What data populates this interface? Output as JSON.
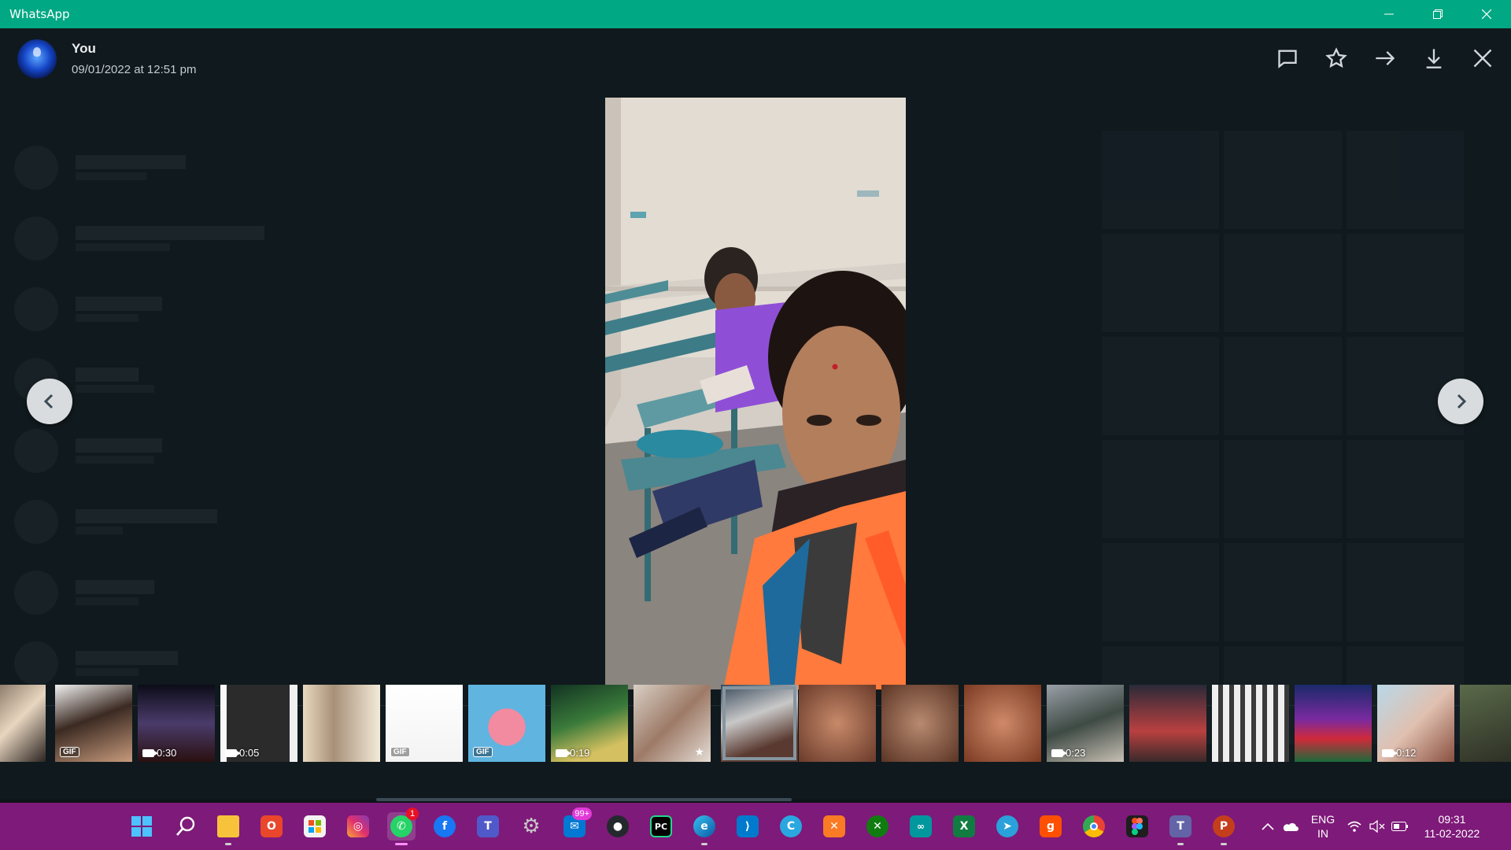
{
  "window": {
    "title": "WhatsApp"
  },
  "header": {
    "sender": "You",
    "timestamp": "09/01/2022 at 12:51 pm",
    "actions": [
      "reply-icon",
      "star-icon",
      "forward-icon",
      "download-icon",
      "close-icon"
    ]
  },
  "thumbnails": [
    {
      "type": "image"
    },
    {
      "type": "gif",
      "label": "GIF"
    },
    {
      "type": "video",
      "duration": "0:30"
    },
    {
      "type": "video",
      "duration": "0:05"
    },
    {
      "type": "image"
    },
    {
      "type": "gif",
      "label": "GIF"
    },
    {
      "type": "gif",
      "label": "GIF"
    },
    {
      "type": "video",
      "duration": "0:19"
    },
    {
      "type": "image",
      "starred": true
    },
    {
      "type": "image",
      "selected": true
    },
    {
      "type": "image"
    },
    {
      "type": "image"
    },
    {
      "type": "image"
    },
    {
      "type": "video",
      "duration": "0:23"
    },
    {
      "type": "image"
    },
    {
      "type": "image"
    },
    {
      "type": "image"
    },
    {
      "type": "video",
      "duration": "0:12"
    },
    {
      "type": "image"
    }
  ],
  "taskbar": {
    "whatsapp_badge": "1",
    "mail_badge": "99+",
    "language_line1": "ENG",
    "language_line2": "IN",
    "clock_time": "09:31",
    "clock_date": "11-02-2022"
  },
  "colors": {
    "titlebar": "#00a884",
    "viewer_bg": "#10191d",
    "taskbar": "#7e1a79"
  }
}
